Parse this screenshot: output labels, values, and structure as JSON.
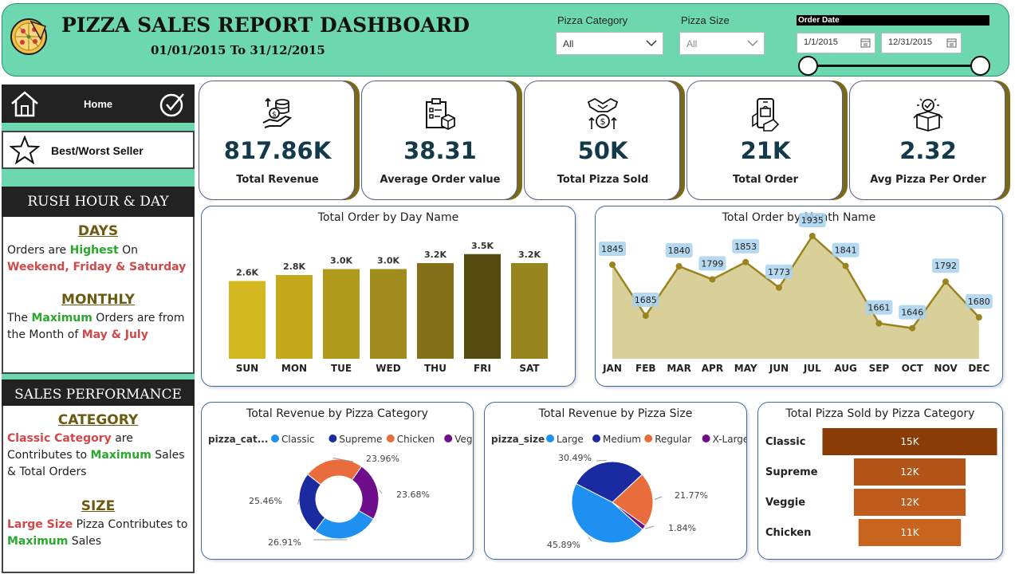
{
  "header": {
    "title": "PIZZA SALES REPORT DASHBOARD",
    "subtitle": "01/01/2015 To 31/12/2015",
    "filters": {
      "category_label": "Pizza Category",
      "category_value": "All",
      "size_label": "Pizza Size",
      "size_value": "All",
      "order_date_label": "Order Date",
      "start_date": "1/1/2015",
      "end_date": "12/31/2015"
    }
  },
  "nav": {
    "home_label": "Home",
    "best_worst_label": "Best/Worst Seller"
  },
  "rush": {
    "heading": "RUSH HOUR & DAY",
    "days_title": "DAYS",
    "days_t1": "Orders are ",
    "days_t2": "Highest",
    "days_t3": " On",
    "days_t4": "Weekend, Friday & Saturday",
    "monthly_title": "MONTHLY",
    "monthly_t1": "The ",
    "monthly_t2": "Maximum",
    "monthly_t3": " Orders are from the Month of ",
    "monthly_t4": "May & July"
  },
  "sales": {
    "heading": "SALES PERFORMANCE",
    "category_title": "CATEGORY",
    "cat_t1": "Classic Category",
    "cat_t2": " are Contributes to ",
    "cat_t3": "Maximum",
    "cat_t4": " Sales & Total Orders",
    "size_title": "SIZE",
    "size_t1": "Large Size",
    "size_t2": " Pizza Contributes to ",
    "size_t3": "Maximum",
    "size_t4": " Sales"
  },
  "kpis": [
    {
      "value": "817.86K",
      "label": "Total Revenue",
      "icon": "revenue-icon"
    },
    {
      "value": "38.31",
      "label": "Average Order value",
      "icon": "order-value-icon"
    },
    {
      "value": "50K",
      "label": "Total Pizza Sold",
      "icon": "handshake-icon"
    },
    {
      "value": "21K",
      "label": "Total Order",
      "icon": "phone-order-icon"
    },
    {
      "value": "2.32",
      "label": "Avg Pizza Per Order",
      "icon": "box-icon"
    }
  ],
  "chart_data": [
    {
      "type": "bar",
      "title": "Total Order by Day Name",
      "categories": [
        "SUN",
        "MON",
        "TUE",
        "WED",
        "THU",
        "FRI",
        "SAT"
      ],
      "values": [
        2.6,
        2.8,
        3.0,
        3.0,
        3.2,
        3.5,
        3.2
      ],
      "data_labels": [
        "2.6K",
        "2.8K",
        "3.0K",
        "3.0K",
        "3.2K",
        "3.5K",
        "3.2K"
      ],
      "colors": [
        "#d4b820",
        "#c4a81c",
        "#b09a1c",
        "#a08c1c",
        "#847018",
        "#554a10",
        "#97861e"
      ]
    },
    {
      "type": "area",
      "title": "Total Order by Month Name",
      "categories": [
        "JAN",
        "FEB",
        "MAR",
        "APR",
        "MAY",
        "JUN",
        "JUL",
        "AUG",
        "SEP",
        "OCT",
        "NOV",
        "DEC"
      ],
      "values": [
        1845,
        1685,
        1840,
        1799,
        1853,
        1773,
        1935,
        1841,
        1661,
        1646,
        1792,
        1680
      ],
      "line_color": "#9a8420",
      "fill_color": "#d9cf99",
      "label_bg": "#a8d2ee"
    },
    {
      "type": "pie",
      "title": "Total Revenue by Pizza Category",
      "legend_title": "pizza_cat...",
      "labels": [
        "Classic",
        "Supreme",
        "Chicken",
        "Veggie"
      ],
      "values": [
        26.91,
        25.46,
        23.96,
        23.68
      ],
      "data_labels": [
        "26.91%",
        "25.46%",
        "23.96%",
        "23.68%"
      ],
      "colors": [
        "#1e90f0",
        "#1a2aa0",
        "#e86c3c",
        "#6e0e8a"
      ],
      "donut": true
    },
    {
      "type": "pie",
      "title": "Total Revenue by Pizza Size",
      "legend_title": "pizza_size",
      "labels": [
        "Large",
        "Medium",
        "Regular",
        "X-Large"
      ],
      "values": [
        45.89,
        30.49,
        21.77,
        1.84
      ],
      "data_labels": [
        "45.89%",
        "30.49%",
        "21.77%",
        "1.84%"
      ],
      "colors": [
        "#1e90f0",
        "#1a2aa0",
        "#e86c3c",
        "#6e0e8a"
      ],
      "donut": false
    },
    {
      "type": "bar",
      "title": "Total Pizza Sold by Pizza Category",
      "orientation": "funnel",
      "categories": [
        "Classic",
        "Supreme",
        "Veggie",
        "Chicken"
      ],
      "values": [
        15,
        12,
        12,
        11
      ],
      "data_labels": [
        "15K",
        "12K",
        "12K",
        "11K"
      ],
      "colors": [
        "#8a3c06",
        "#b35418",
        "#bf5c1c",
        "#c8641e"
      ]
    }
  ]
}
